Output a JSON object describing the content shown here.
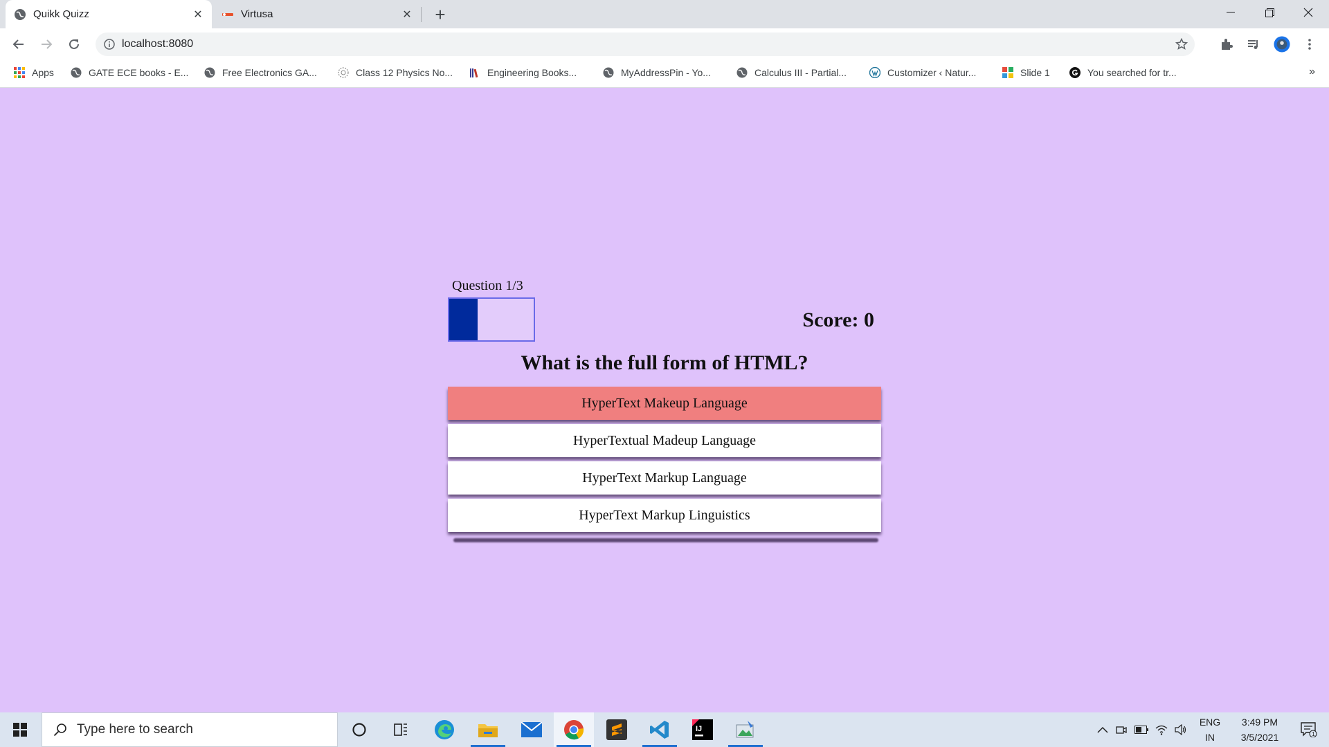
{
  "browser": {
    "tabs": [
      {
        "title": "Quikk Quizz",
        "active": true
      },
      {
        "title": "Virtusa",
        "active": false
      }
    ],
    "url": "localhost:8080",
    "bookmarks": [
      {
        "label": "Apps"
      },
      {
        "label": "GATE ECE books - E..."
      },
      {
        "label": "Free Electronics GA..."
      },
      {
        "label": "Class 12 Physics No..."
      },
      {
        "label": "Engineering Books..."
      },
      {
        "label": "MyAddressPin - Yo..."
      },
      {
        "label": "Calculus III - Partial..."
      },
      {
        "label": "Customizer ‹ Natur..."
      },
      {
        "label": "Slide 1"
      },
      {
        "label": "You searched for tr..."
      }
    ],
    "bookmarks_more": "»"
  },
  "quiz": {
    "question_counter": "Question 1/3",
    "progress": 0.3333,
    "score_text": "Score: 0",
    "question": "What is the full form of HTML?",
    "answers": [
      {
        "text": "HyperText Makeup Language",
        "state": "wrong"
      },
      {
        "text": "HyperTextual Madeup Language",
        "state": "normal"
      },
      {
        "text": "HyperText Markup Language",
        "state": "normal"
      },
      {
        "text": "HyperText Markup Linguistics",
        "state": "normal"
      }
    ],
    "colors": {
      "background": "#dfc2fb",
      "wrong_answer": "#f07f7f",
      "progress_fill": "#002a9c",
      "progress_border": "#6a6ae8"
    }
  },
  "taskbar": {
    "search_placeholder": "Type here to search",
    "apps": [
      "cortana-icon",
      "task-view-icon",
      "edge-icon",
      "file-explorer-icon",
      "mail-icon",
      "chrome-icon",
      "sublime-text-icon",
      "vscode-icon",
      "intellij-icon",
      "app-icon"
    ],
    "language": "ENG",
    "region": "IN",
    "time": "3:49 PM",
    "date": "3/5/2021",
    "notification_count": "1"
  }
}
